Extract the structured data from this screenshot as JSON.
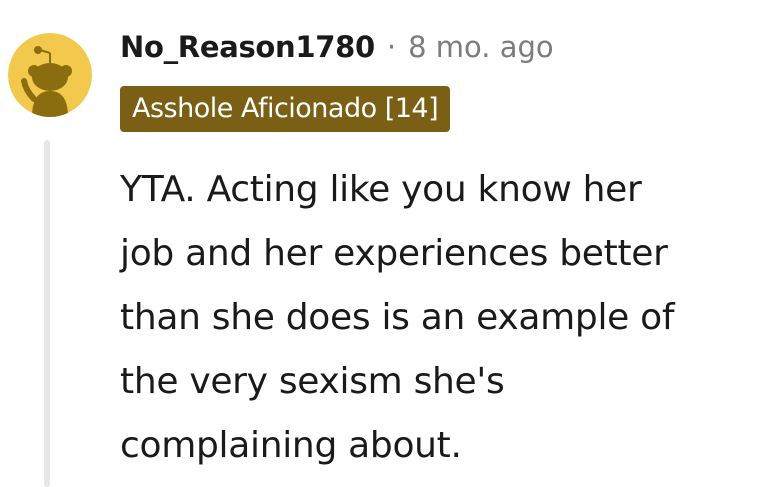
{
  "comment": {
    "author": "No_Reason1780",
    "separator": "·",
    "timestamp": "8 mo. ago",
    "flair": "Asshole Aficionado [14]",
    "body": "YTA. Acting like you know her\njob and her experiences better\nthan she does is an example of\nthe very sexism she's\ncomplaining about."
  },
  "colors": {
    "avatar_background": "#f2c94c",
    "flair_background": "#7a5f14",
    "thread_line": "#e5e7eb"
  },
  "icons": {
    "avatar": "snoo-avatar-icon"
  }
}
